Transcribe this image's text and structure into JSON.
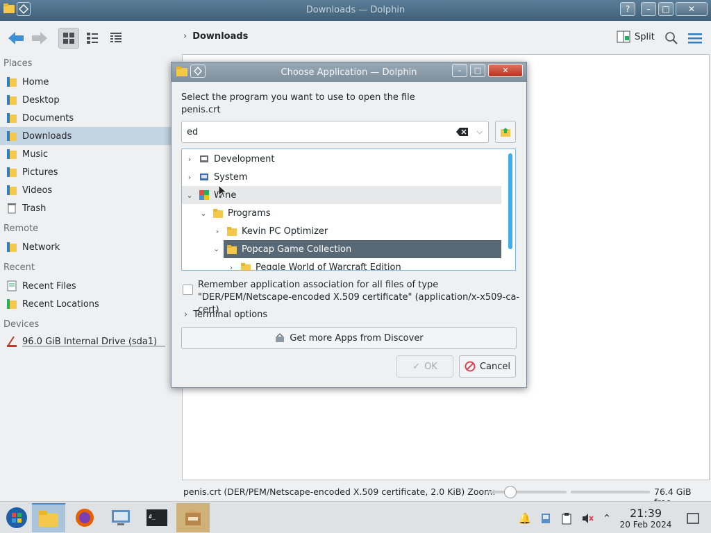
{
  "window": {
    "title": "Downloads — Dolphin",
    "help_label": "?",
    "minimize_label": "–",
    "maximize_label": "□",
    "close_label": "✕"
  },
  "toolbar": {
    "breadcrumb": "Downloads",
    "split_label": "Split"
  },
  "places": {
    "sections": [
      {
        "title": "Places",
        "items": [
          "Home",
          "Desktop",
          "Documents",
          "Downloads",
          "Music",
          "Pictures",
          "Videos",
          "Trash"
        ]
      },
      {
        "title": "Remote",
        "items": [
          "Network"
        ]
      },
      {
        "title": "Recent",
        "items": [
          "Recent Files",
          "Recent Locations"
        ]
      },
      {
        "title": "Devices",
        "items": [
          "96.0 GiB Internal Drive (sda1)"
        ]
      }
    ],
    "selected": "Downloads"
  },
  "status": {
    "file_info": "penis.crt (DER/PEM/Netscape-encoded X.509 certificate, 2.0 KiB)",
    "zoom_label": "Zoom:",
    "free_space": "76.4 GiB free"
  },
  "dialog": {
    "title": "Choose Application — Dolphin",
    "prompt_line1": "Select the program you want to use to open the file",
    "prompt_line2": "penis.crt",
    "search_value": "ed",
    "tree": [
      {
        "label": "Development",
        "level": 0,
        "expanded": false,
        "state": "normal"
      },
      {
        "label": "System",
        "level": 0,
        "expanded": false,
        "state": "normal"
      },
      {
        "label": "Wine",
        "level": 0,
        "expanded": true,
        "state": "hover"
      },
      {
        "label": "Programs",
        "level": 1,
        "expanded": true,
        "state": "normal"
      },
      {
        "label": "Kevin PC Optimizer",
        "level": 2,
        "expanded": false,
        "state": "normal"
      },
      {
        "label": "Popcap Game Collection",
        "level": 2,
        "expanded": true,
        "state": "selected"
      },
      {
        "label": "Peggle World of Warcraft Edition",
        "level": 3,
        "expanded": false,
        "state": "normal"
      }
    ],
    "remember_line1": "Remember application association for all files of type",
    "remember_line2": "\"DER/PEM/Netscape-encoded X.509 certificate\" (application/x-x509-ca-cert)",
    "remember_checked": false,
    "terminal_options": "Terminal options",
    "discover_label": "Get more Apps from Discover",
    "ok_label": "OK",
    "cancel_label": "Cancel"
  },
  "taskbar": {
    "time": "21:39",
    "date": "20 Feb 2024"
  },
  "colors": {
    "accent": "#3daee9",
    "selection": "#586874",
    "places_selection": "#c3d5e3"
  }
}
